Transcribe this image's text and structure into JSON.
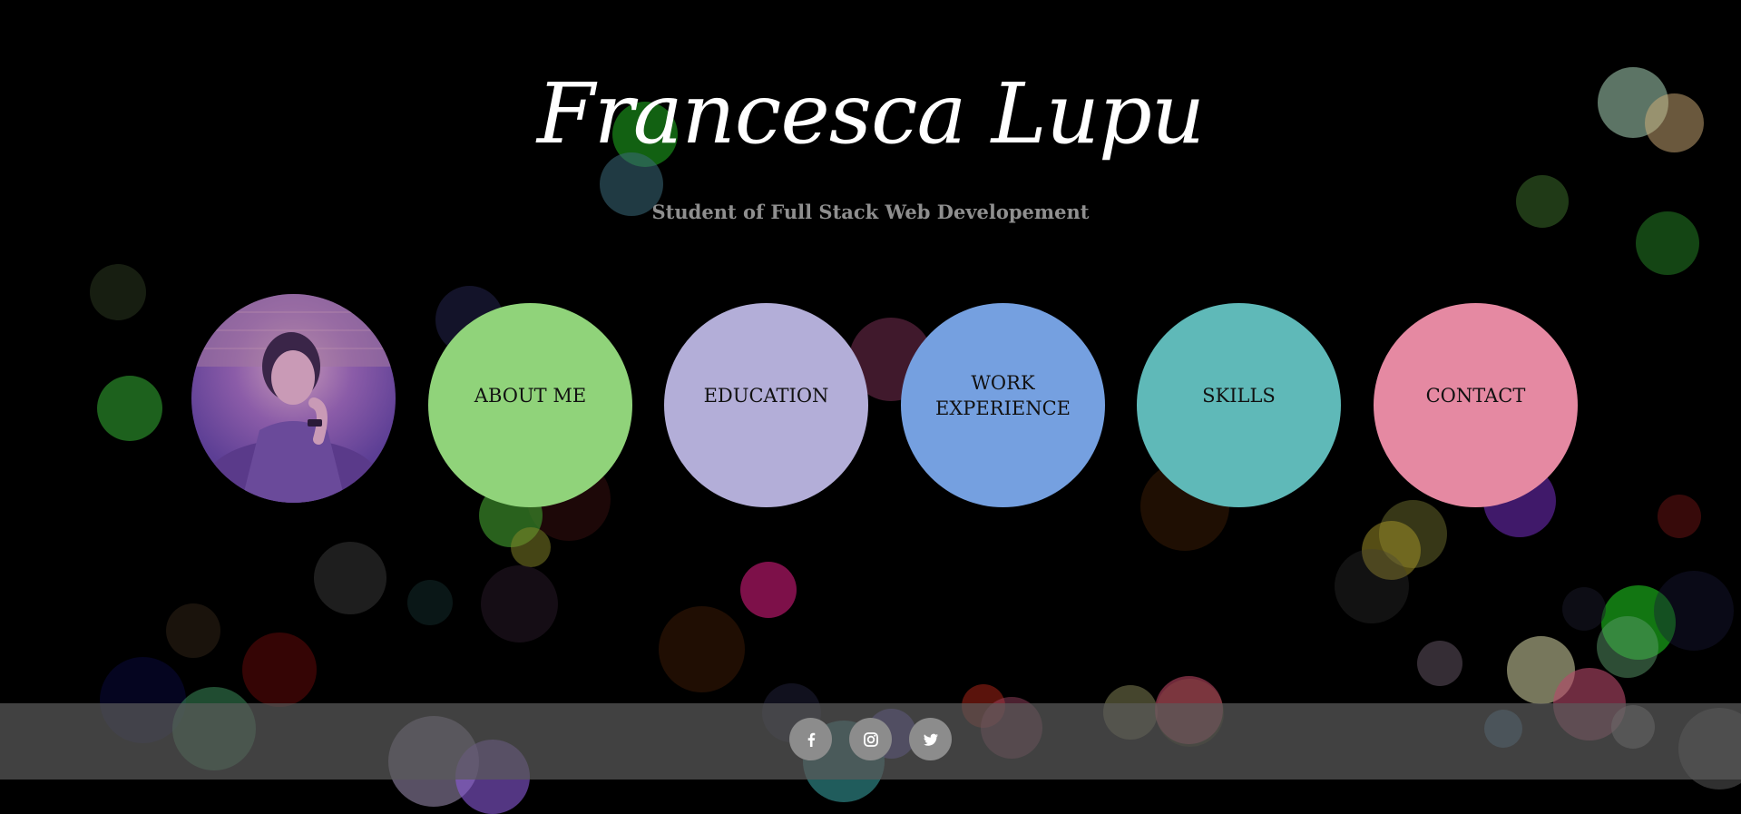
{
  "header": {
    "title": "Francesca Lupu",
    "subtitle": "Student of Full Stack Web Developement"
  },
  "profile": {
    "photo_description": "profile photo"
  },
  "nav": {
    "items": [
      {
        "label": "ABOUT ME",
        "color": "#90d37a"
      },
      {
        "label": "EDUCATION",
        "color": "#b3aed8"
      },
      {
        "label": "WORK EXPERIENCE",
        "color": "#75a0e0"
      },
      {
        "label": "SKILLS",
        "color": "#5fb9b8"
      },
      {
        "label": "CONTACT",
        "color": "#e589a2"
      }
    ]
  },
  "footer": {
    "social": [
      {
        "icon": "facebook-icon"
      },
      {
        "icon": "instagram-icon"
      },
      {
        "icon": "twitter-icon"
      }
    ]
  },
  "colors": {
    "background": "#000000",
    "footer": "#5a5a5a",
    "social_button": "#8c8c8c"
  }
}
